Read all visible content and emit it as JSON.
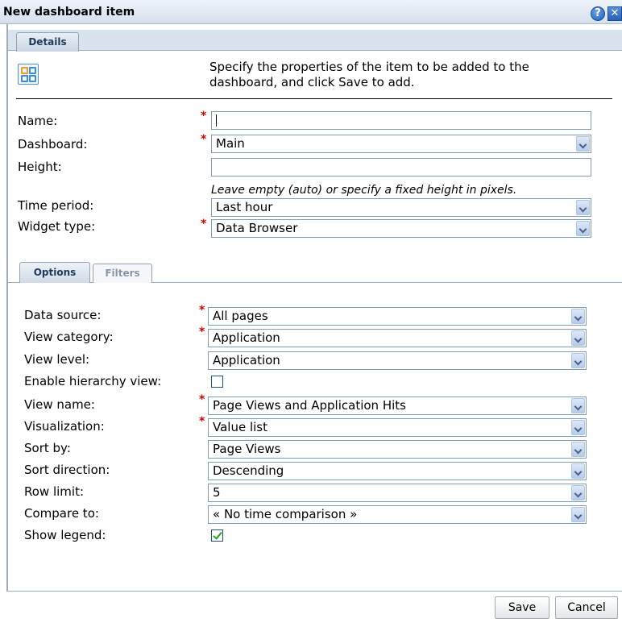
{
  "dialog": {
    "title": "New dashboard item",
    "help_icon": "question-icon",
    "close_icon": "close-icon"
  },
  "tabs_top": {
    "details": "Details"
  },
  "intro": {
    "icon": "dashboard-grid-icon",
    "text": "Specify the properties of the item to be added to the dashboard, and click Save to add."
  },
  "form": {
    "name": {
      "label": "Name:",
      "value": "",
      "required": true
    },
    "dashboard": {
      "label": "Dashboard:",
      "value": "Main",
      "required": true
    },
    "height": {
      "label": "Height:",
      "value": "",
      "hint": "Leave empty (auto) or specify a fixed height in pixels."
    },
    "time_period": {
      "label": "Time period:",
      "value": "Last hour"
    },
    "widget_type": {
      "label": "Widget type:",
      "value": "Data Browser",
      "required": true
    }
  },
  "tabs_options": {
    "options": "Options",
    "filters": "Filters",
    "active": "Options"
  },
  "options": {
    "data_source": {
      "label": "Data source:",
      "value": "All pages",
      "required": true
    },
    "view_category": {
      "label": "View category:",
      "value": "Application",
      "required": true
    },
    "view_level": {
      "label": "View level:",
      "value": "Application"
    },
    "hierarchy": {
      "label": "Enable hierarchy view:",
      "checked": false
    },
    "view_name": {
      "label": "View name:",
      "value": "Page Views and Application Hits",
      "required": true
    },
    "visualization": {
      "label": "Visualization:",
      "value": "Value list",
      "required": true
    },
    "sort_by": {
      "label": "Sort by:",
      "value": "Page Views"
    },
    "sort_direction": {
      "label": "Sort direction:",
      "value": "Descending"
    },
    "row_limit": {
      "label": "Row limit:",
      "value": "5"
    },
    "compare_to": {
      "label": "Compare to:",
      "value": "« No time comparison »"
    },
    "show_legend": {
      "label": "Show legend:",
      "checked": true
    }
  },
  "buttons": {
    "save": "Save",
    "cancel": "Cancel"
  },
  "colors": {
    "required_marker": "#d40000",
    "checkmark": "#21a121",
    "field_border": "#7f9db9"
  }
}
